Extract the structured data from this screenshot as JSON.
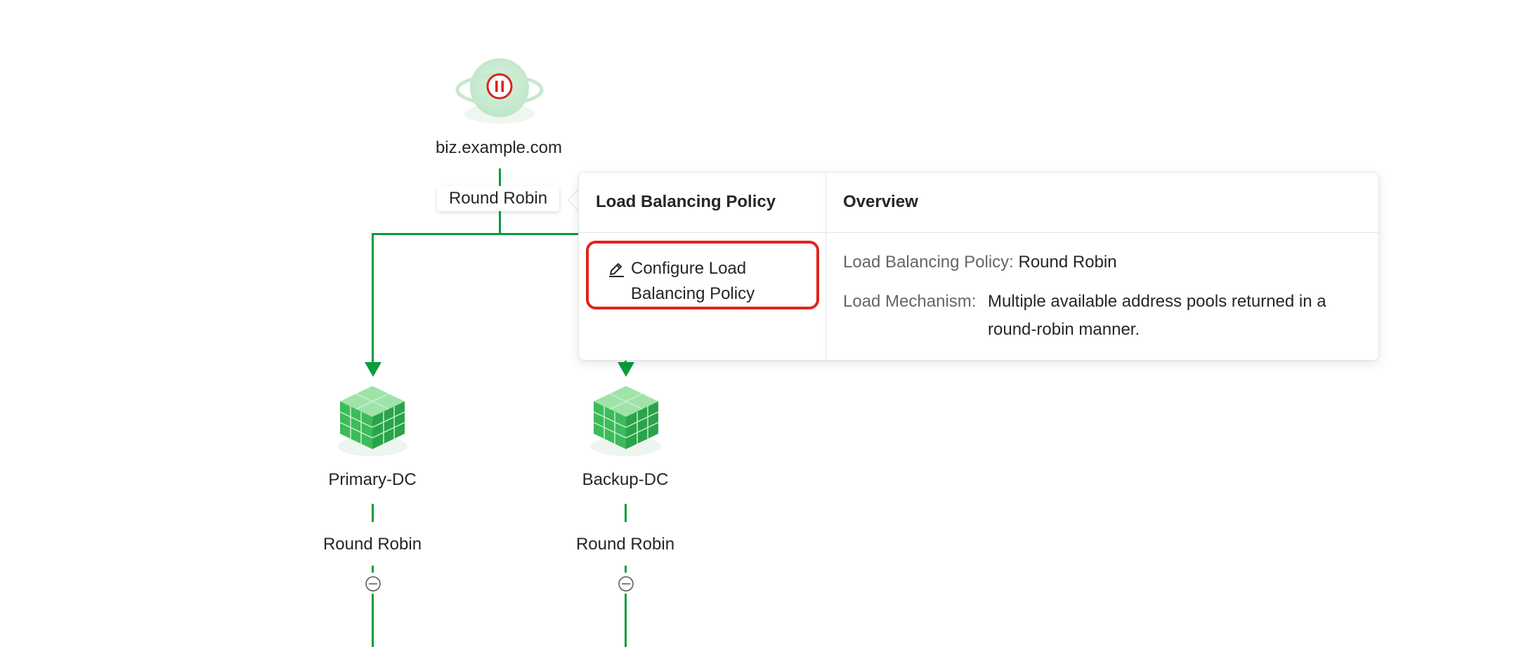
{
  "root_node": {
    "name": "biz.example.com",
    "policy": "Round Robin",
    "icon": "globe-pause-icon",
    "status_color": "#d9231a"
  },
  "popover": {
    "left_header": "Load Balancing Policy",
    "right_header": "Overview",
    "configure_label": "Configure Load Balancing Policy",
    "overview": {
      "policy_key": "Load Balancing Policy:",
      "policy_value": "Round Robin",
      "mechanism_key": "Load Mechanism:",
      "mechanism_value": "Multiple available address pools returned in a round-robin manner."
    },
    "highlight_color": "#e2231a"
  },
  "datacenters": [
    {
      "name": "Primary-DC",
      "policy": "Round Robin",
      "icon": "datacenter-cube-icon"
    },
    {
      "name": "Backup-DC",
      "policy": "Round Robin",
      "icon": "datacenter-cube-icon"
    }
  ],
  "colors": {
    "line": "#0a9d3b",
    "accent": "#2db85c"
  }
}
